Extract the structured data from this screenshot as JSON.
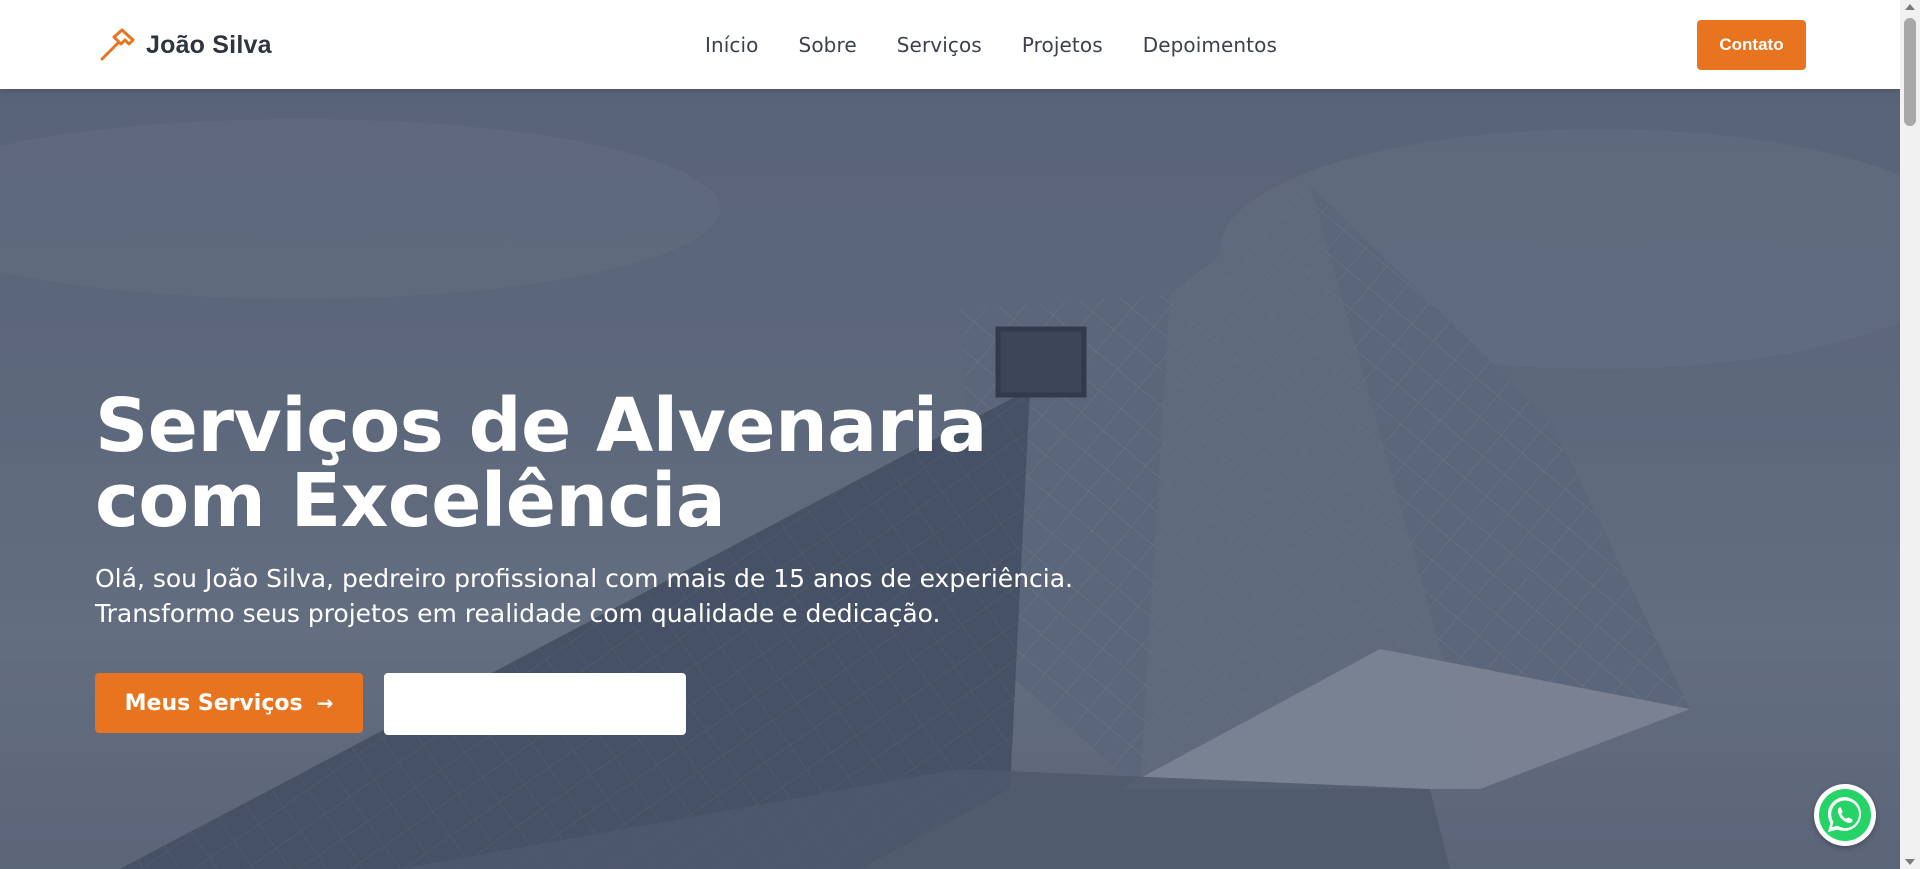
{
  "brand": {
    "name": "João Silva",
    "icon": "hammer-icon"
  },
  "nav": {
    "items": [
      {
        "label": "Início"
      },
      {
        "label": "Sobre"
      },
      {
        "label": "Serviços"
      },
      {
        "label": "Projetos"
      },
      {
        "label": "Depoimentos"
      }
    ]
  },
  "header": {
    "contact_label": "Contato"
  },
  "hero": {
    "title_line1": "Serviços de Alvenaria",
    "title_line2": "com Excelência",
    "subtitle_line1": "Olá, sou João Silva, pedreiro profissional com mais de 15 anos de experiência.",
    "subtitle_line2": "Transformo seus projetos em realidade com qualidade e dedicação.",
    "primary_button": {
      "label": "Meus Serviços",
      "icon": "arrow-right-icon"
    },
    "secondary_button": {
      "label": ""
    }
  },
  "floating": {
    "whatsapp_icon": "whatsapp-icon"
  },
  "colors": {
    "accent": "#e8741f",
    "text_dark": "#2e3440",
    "whatsapp": "#25d366"
  }
}
